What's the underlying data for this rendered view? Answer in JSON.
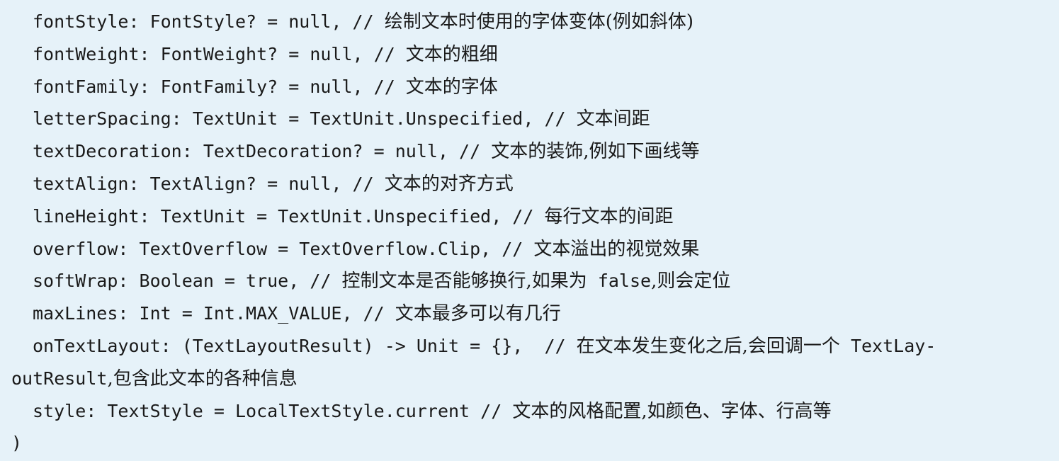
{
  "lines": [
    {
      "code": "fontStyle: FontStyle? = null, // ",
      "comment": "绘制文本时使用的字体变体(例如斜体)"
    },
    {
      "code": "fontWeight: FontWeight? = null, // ",
      "comment": "文本的粗细"
    },
    {
      "code": "fontFamily: FontFamily? = null, // ",
      "comment": "文本的字体"
    },
    {
      "code": "letterSpacing: TextUnit = TextUnit.Unspecified, // ",
      "comment": "文本间距"
    },
    {
      "code": "textDecoration: TextDecoration? = null, // ",
      "comment": "文本的装饰,例如下画线等"
    },
    {
      "code": "textAlign: TextAlign? = null, // ",
      "comment": "文本的对齐方式"
    },
    {
      "code": "lineHeight: TextUnit = TextUnit.Unspecified, // ",
      "comment": "每行文本的间距"
    },
    {
      "code": "overflow: TextOverflow = TextOverflow.Clip, // ",
      "comment": "文本溢出的视觉效果"
    },
    {
      "code": "softWrap: Boolean = true, // ",
      "comment": "控制文本是否能够换行,如果为",
      "code2": " false",
      "comment2": ",则会定位"
    },
    {
      "code": "maxLines: Int = Int.MAX_VALUE, // ",
      "comment": "文本最多可以有几行"
    },
    {
      "code": "onTextLayout: (TextLayoutResult) -> Unit = {},  // ",
      "comment": "在文本发生变化之后,会回调一个",
      "code2": " TextLay-"
    },
    {
      "code": "outResult",
      "comment": ",包含此文本的各种信息"
    },
    {
      "code": "style: TextStyle = LocalTextStyle.current // ",
      "comment": "文本的风格配置,如颜色、字体、行高等"
    },
    {
      "code": ")",
      "comment": ""
    }
  ]
}
